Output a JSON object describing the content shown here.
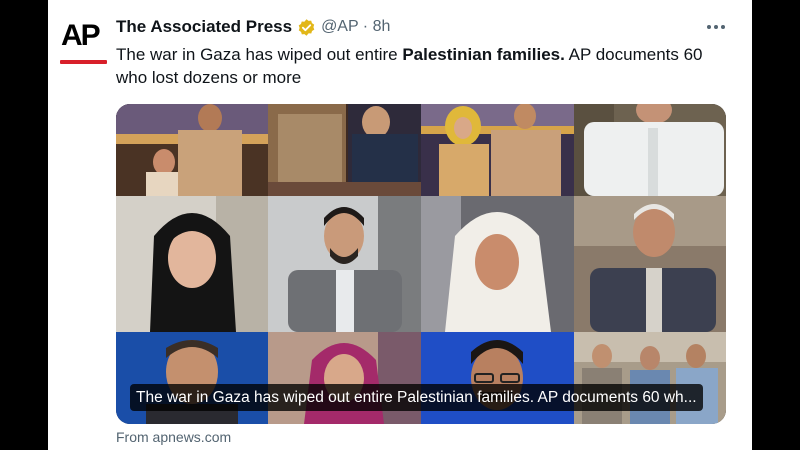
{
  "tweet": {
    "author_name": "The Associated Press",
    "verified_icon": "gold-verified-check-icon",
    "handle_time": "@AP · 8h",
    "text_before": "The war in Gaza has wiped out entire ",
    "text_bold": "Palestinian families.",
    "text_after": " AP documents 60 who lost dozens or more",
    "avatar_text": "AP",
    "more_icon": "more-horizontal-icon"
  },
  "card": {
    "caption": "The war in Gaza has wiped out entire Palestinian families. AP documents 60 wh...",
    "source": "From apnews.com"
  },
  "colors": {
    "verified_gold": "#e2b719",
    "ap_red": "#d8202a",
    "text_primary": "#0f1419",
    "text_secondary": "#536471"
  }
}
